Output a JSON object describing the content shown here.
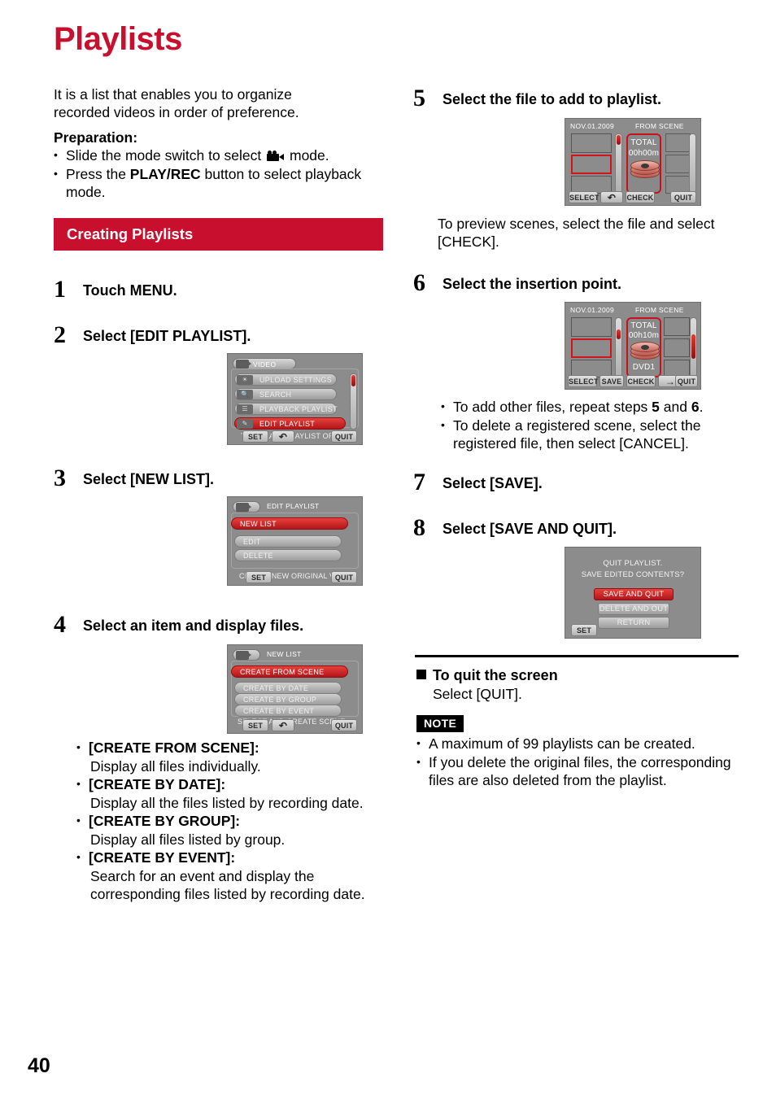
{
  "page": {
    "title": "Playlists",
    "number": "40",
    "accent_color": "#C8102E"
  },
  "intro": {
    "description": "It is a list that enables you to organize recorded videos in order of preference.",
    "preparation_heading": "Preparation:",
    "preparation_items": [
      {
        "pre": "Slide the mode switch to select ",
        "icon": "video-camera-icon",
        "post": " mode."
      },
      {
        "pre": "Press the ",
        "bold": "PLAY/REC",
        "post": " button to select playback mode."
      }
    ]
  },
  "section": {
    "banner": "Creating Playlists"
  },
  "steps": [
    {
      "num": "1",
      "text": "Touch MENU."
    },
    {
      "num": "2",
      "text": "Select [EDIT PLAYLIST]."
    },
    {
      "num": "3",
      "text": "Select [NEW LIST]."
    },
    {
      "num": "4",
      "text": "Select an item and display files."
    },
    {
      "num": "5",
      "text": "Select the file to add to playlist."
    },
    {
      "num": "6",
      "text": "Select the insertion point."
    },
    {
      "num": "7",
      "text": "Select [SAVE]."
    },
    {
      "num": "8",
      "text": "Select [SAVE AND QUIT]."
    }
  ],
  "screen_menu": {
    "tab_label": "VIDEO",
    "rows": [
      {
        "label": "UPLOAD SETTINGS",
        "selected": false
      },
      {
        "label": "SEARCH",
        "selected": false
      },
      {
        "label": "PLAYBACK PLAYLIST",
        "selected": false
      },
      {
        "label": "EDIT PLAYLIST",
        "selected": true
      }
    ],
    "hint": "TO CREATE PLAYLIST ORDER",
    "buttons": {
      "set": "SET",
      "back": "↶",
      "quit": "QUIT"
    }
  },
  "screen_edit_playlist": {
    "title": "EDIT PLAYLIST",
    "rows": [
      {
        "label": "NEW LIST",
        "selected": true
      },
      {
        "label": "EDIT",
        "selected": false
      },
      {
        "label": "DELETE",
        "selected": false
      }
    ],
    "hint": "CREATE NEW ORIGINAL VIDEO",
    "buttons": {
      "set": "SET",
      "quit": "QUIT"
    }
  },
  "screen_new_list": {
    "title": "NEW LIST",
    "rows": [
      {
        "label": "CREATE FROM SCENE",
        "selected": true
      },
      {
        "label": "CREATE BY DATE",
        "selected": false
      },
      {
        "label": "CREATE BY GROUP",
        "selected": false
      },
      {
        "label": "CREATE BY EVENT",
        "selected": false
      }
    ],
    "hint": "SELECT AND CREATE SCENE",
    "buttons": {
      "set": "SET",
      "back": "↶",
      "quit": "QUIT"
    }
  },
  "screen_from_scene_5": {
    "date": "NOV.01.2009",
    "mode": "FROM SCENE",
    "total_label": "TOTAL",
    "total_time": "00h00m",
    "buttons": {
      "select": "SELECT",
      "back": "↶",
      "check": "CHECK",
      "quit": "QUIT"
    }
  },
  "screen_from_scene_6": {
    "date": "NOV.01.2009",
    "mode": "FROM SCENE",
    "total_label": "TOTAL",
    "total_time": "00h10m",
    "disc_label": "DVD1",
    "buttons": {
      "select": "SELECT",
      "save": "SAVE",
      "check": "CHECK",
      "next": "→",
      "quit": "QUIT"
    }
  },
  "screen_quit_dialog": {
    "line1": "QUIT PLAYLIST.",
    "line2": "SAVE EDITED CONTENTS?",
    "options": [
      {
        "label": "SAVE AND QUIT",
        "selected": true
      },
      {
        "label": "DELETE AND OUT",
        "selected": false
      },
      {
        "label": "RETURN",
        "selected": false
      }
    ],
    "buttons": {
      "set": "SET"
    }
  },
  "step5_note": "To preview scenes, select the file and select [CHECK].",
  "step6_notes": [
    {
      "pre": "To add other files, repeat steps ",
      "b1": "5",
      "mid": " and ",
      "b2": "6",
      "post": "."
    },
    {
      "text": "To delete a registered scene, select the registered file, then select [CANCEL]."
    }
  ],
  "step4_options": [
    {
      "term": "[CREATE FROM SCENE]:",
      "desc": "Display all files individually."
    },
    {
      "term": "[CREATE BY DATE]:",
      "desc": "Display all the files listed by recording date."
    },
    {
      "term": "[CREATE BY GROUP]:",
      "desc": "Display all files listed by group."
    },
    {
      "term": "[CREATE BY EVENT]:",
      "desc": "Search for an event and display the corresponding files listed by recording date."
    }
  ],
  "quit_screen": {
    "heading": "To quit the screen",
    "body": "Select [QUIT]."
  },
  "note": {
    "tag": "NOTE",
    "items": [
      "A maximum of 99 playlists can be created.",
      "If you delete the original files, the corresponding files are also deleted from the playlist."
    ]
  }
}
